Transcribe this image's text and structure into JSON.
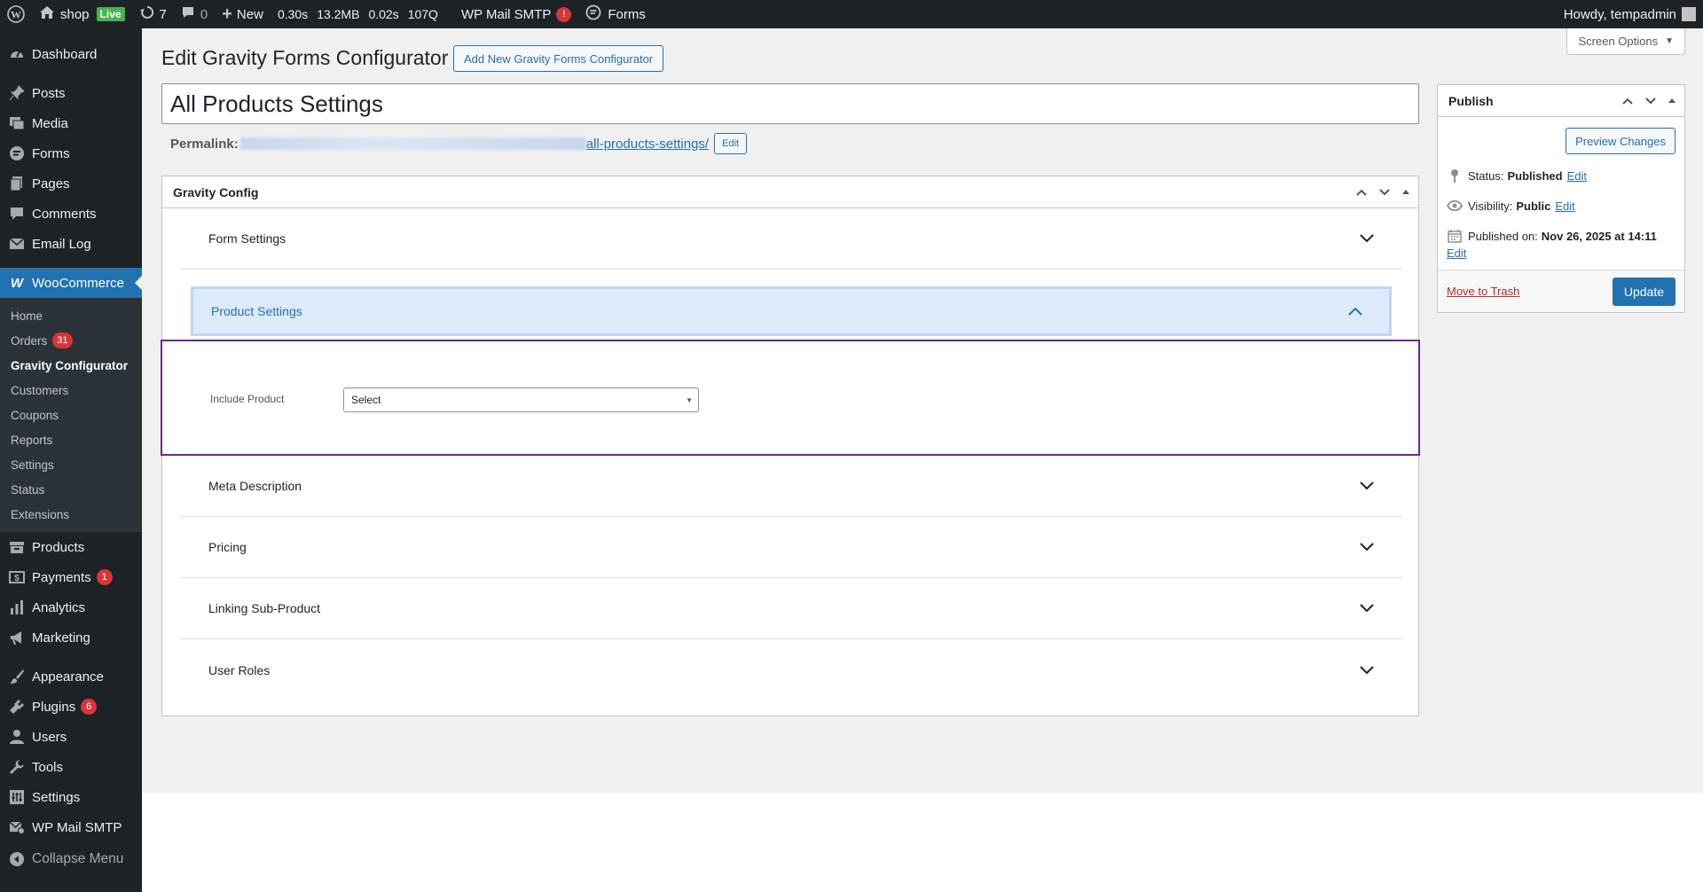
{
  "admin_bar": {
    "site_name": "shop",
    "live_badge": "Live",
    "updates_count": "7",
    "comments_count": "0",
    "new_label": "New",
    "perf": [
      "0.30s",
      "13.2MB",
      "0.02s",
      "107Q"
    ],
    "smtp_label": "WP Mail SMTP",
    "smtp_alert": "!",
    "forms_label": "Forms",
    "howdy": "Howdy, tempadmin"
  },
  "sidebar": {
    "dashboard": "Dashboard",
    "posts": "Posts",
    "media": "Media",
    "forms": "Forms",
    "pages": "Pages",
    "comments": "Comments",
    "email_log": "Email Log",
    "woocommerce": "WooCommerce",
    "woo_sub": {
      "home": "Home",
      "orders": "Orders",
      "orders_badge": "31",
      "gravity": "Gravity Configurator",
      "customers": "Customers",
      "coupons": "Coupons",
      "reports": "Reports",
      "settings": "Settings",
      "status": "Status",
      "extensions": "Extensions"
    },
    "products": "Products",
    "payments": "Payments",
    "payments_badge": "1",
    "analytics": "Analytics",
    "marketing": "Marketing",
    "appearance": "Appearance",
    "plugins": "Plugins",
    "plugins_badge": "6",
    "users": "Users",
    "tools": "Tools",
    "settings": "Settings",
    "wp_mail_smtp": "WP Mail SMTP",
    "collapse": "Collapse Menu"
  },
  "page": {
    "title": "Edit Gravity Forms Configurator",
    "add_new": "Add New Gravity Forms Configurator",
    "screen_options": "Screen Options",
    "post_title": "All Products Settings",
    "permalink_label": "Permalink:",
    "permalink_slug": "all-products-settings/",
    "permalink_edit": "Edit"
  },
  "metabox": {
    "title": "Gravity Config",
    "sections": {
      "form_settings": "Form Settings",
      "product_settings": "Product Settings",
      "meta_description": "Meta Description",
      "pricing": "Pricing",
      "linking": "Linking Sub-Product",
      "user_roles": "User Roles"
    },
    "include_product_label": "Include Product",
    "include_product_value": "Select"
  },
  "publish": {
    "title": "Publish",
    "preview": "Preview Changes",
    "status_label": "Status:",
    "status_value": "Published",
    "visibility_label": "Visibility:",
    "visibility_value": "Public",
    "published_label": "Published on:",
    "published_value": "Nov 26, 2025 at 14:11",
    "edit": "Edit",
    "trash": "Move to Trash",
    "update": "Update"
  }
}
